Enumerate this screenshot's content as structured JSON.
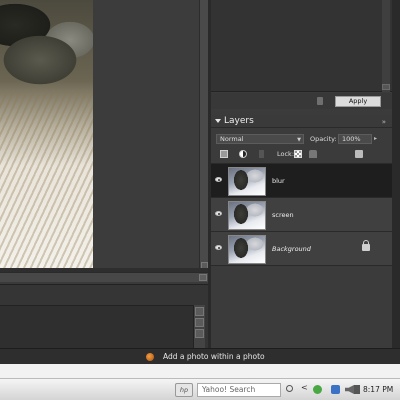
{
  "layers_panel": {
    "title": "Layers",
    "menu_glyph": "»",
    "blend_mode": "Normal",
    "opacity_label": "Opacity:",
    "opacity_value": "100%",
    "lock_label": "Lock:",
    "layers": [
      {
        "name": "blur",
        "selected": true,
        "locked": false
      },
      {
        "name": "screen",
        "selected": false,
        "locked": false
      },
      {
        "name": "Background",
        "selected": false,
        "locked": true
      }
    ]
  },
  "effects": {
    "apply_label": "Apply"
  },
  "status": {
    "tip_text": "Add a photo within a photo"
  },
  "taskbar": {
    "hp_label": "hp",
    "search_placeholder": "Yahoo! Search",
    "clock": "8:17 PM"
  }
}
